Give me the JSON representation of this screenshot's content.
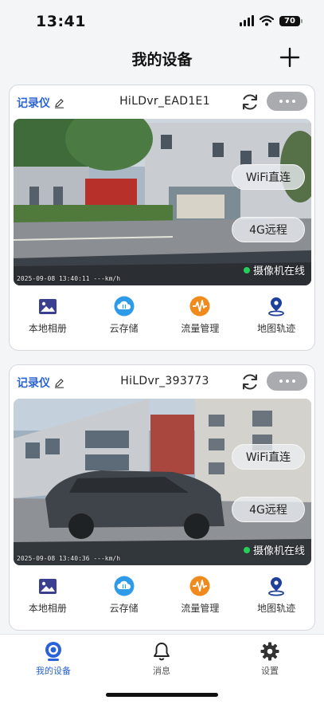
{
  "status_bar": {
    "time": "13:41",
    "battery": "70"
  },
  "header": {
    "title": "我的设备"
  },
  "devices": [
    {
      "type_label": "记录仪",
      "name": "HiLDvr_EAD1E1",
      "wifi_label": "WiFi直连",
      "remote_label": "4G远程",
      "online_label": "摄像机在线",
      "timestamp": "2025-09-08 13:40:11 ---km/h"
    },
    {
      "type_label": "记录仪",
      "name": "HiLDvr_393773",
      "wifi_label": "WiFi直连",
      "remote_label": "4G远程",
      "online_label": "摄像机在线",
      "timestamp": "2025-09-08 13:40:36 ---km/h"
    }
  ],
  "actions": [
    "本地相册",
    "云存储",
    "流量管理",
    "地图轨迹"
  ],
  "tab_bar": {
    "items": [
      {
        "label": "我的设备",
        "active": true
      },
      {
        "label": "消息",
        "active": false
      },
      {
        "label": "设置",
        "active": false
      }
    ]
  },
  "colors": {
    "accent": "#2a63d8",
    "online": "#25d05a",
    "cloud": "#2e9be8",
    "traffic": "#f08a1c",
    "gallery": "#3b3f8f"
  }
}
